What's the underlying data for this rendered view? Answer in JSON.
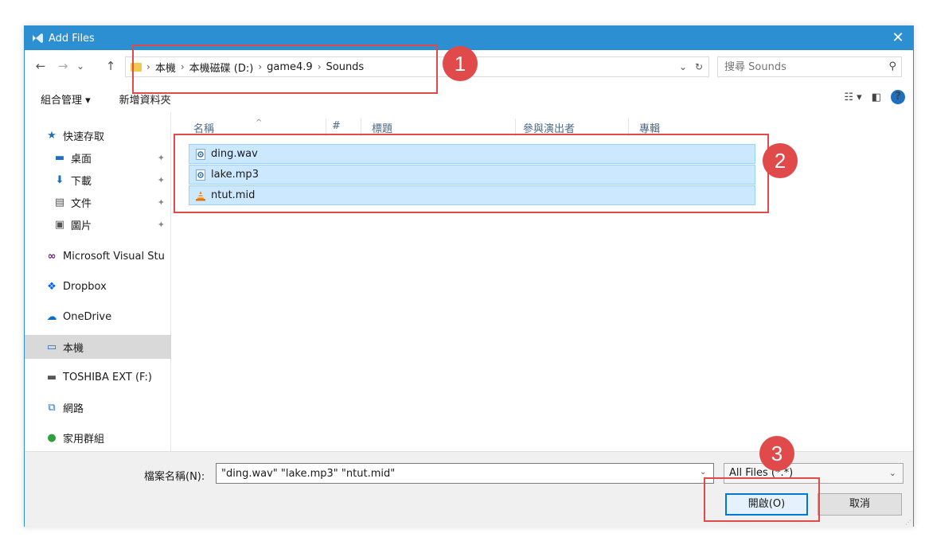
{
  "window": {
    "title": "Add Files",
    "close_glyph": "✕"
  },
  "nav": {
    "back": "←",
    "forward": "→",
    "recent": "⌄",
    "up": "↑",
    "breadcrumbs": [
      "本機",
      "本機磁碟 (D:)",
      "game4.9",
      "Sounds"
    ],
    "crumb_sep": "›",
    "addr_dropdown": "⌄",
    "refresh": "↻",
    "search_placeholder": "搜尋 Sounds",
    "search_icon": "⚲"
  },
  "toolbar": {
    "organize": "組合管理 ▾",
    "new_folder": "新增資料夾",
    "view_icon": "☷ ▾",
    "pane_icon": "◧",
    "help": "?"
  },
  "sidebar": {
    "items": [
      {
        "label": "快速存取",
        "icon": "★"
      },
      {
        "label": "桌面",
        "icon": "▬"
      },
      {
        "label": "下載",
        "icon": "⬇"
      },
      {
        "label": "文件",
        "icon": "▤"
      },
      {
        "label": "圖片",
        "icon": "▣"
      },
      {
        "label": "Microsoft Visual Stu",
        "icon": "∞"
      },
      {
        "label": "Dropbox",
        "icon": "❖"
      },
      {
        "label": "OneDrive",
        "icon": "☁"
      },
      {
        "label": "本機",
        "icon": "▭"
      },
      {
        "label": "TOSHIBA EXT (F:)",
        "icon": "▬"
      },
      {
        "label": "網路",
        "icon": "⧉"
      },
      {
        "label": "家用群組",
        "icon": "●"
      }
    ],
    "pin_glyph": "✦"
  },
  "file_list": {
    "columns": [
      "名稱",
      "#",
      "標題",
      "參與演出者",
      "專輯"
    ],
    "sort_indicator": "^",
    "files": [
      {
        "name": "ding.wav",
        "icon": "audio-file-icon"
      },
      {
        "name": "lake.mp3",
        "icon": "audio-file-icon"
      },
      {
        "name": "ntut.mid",
        "icon": "vlc-cone-icon"
      }
    ]
  },
  "bottom": {
    "filename_label": "檔案名稱(N):",
    "filename_value": "\"ding.wav\" \"lake.mp3\" \"ntut.mid\"",
    "filter_value": "All Files (*.*)",
    "open_button": "開啟(O)",
    "cancel_button": "取消"
  },
  "annotations": [
    "1",
    "2",
    "3"
  ],
  "colors": {
    "accent": "#2b8fd2",
    "selection": "#cce8ff",
    "annotation": "#e04a4a"
  }
}
